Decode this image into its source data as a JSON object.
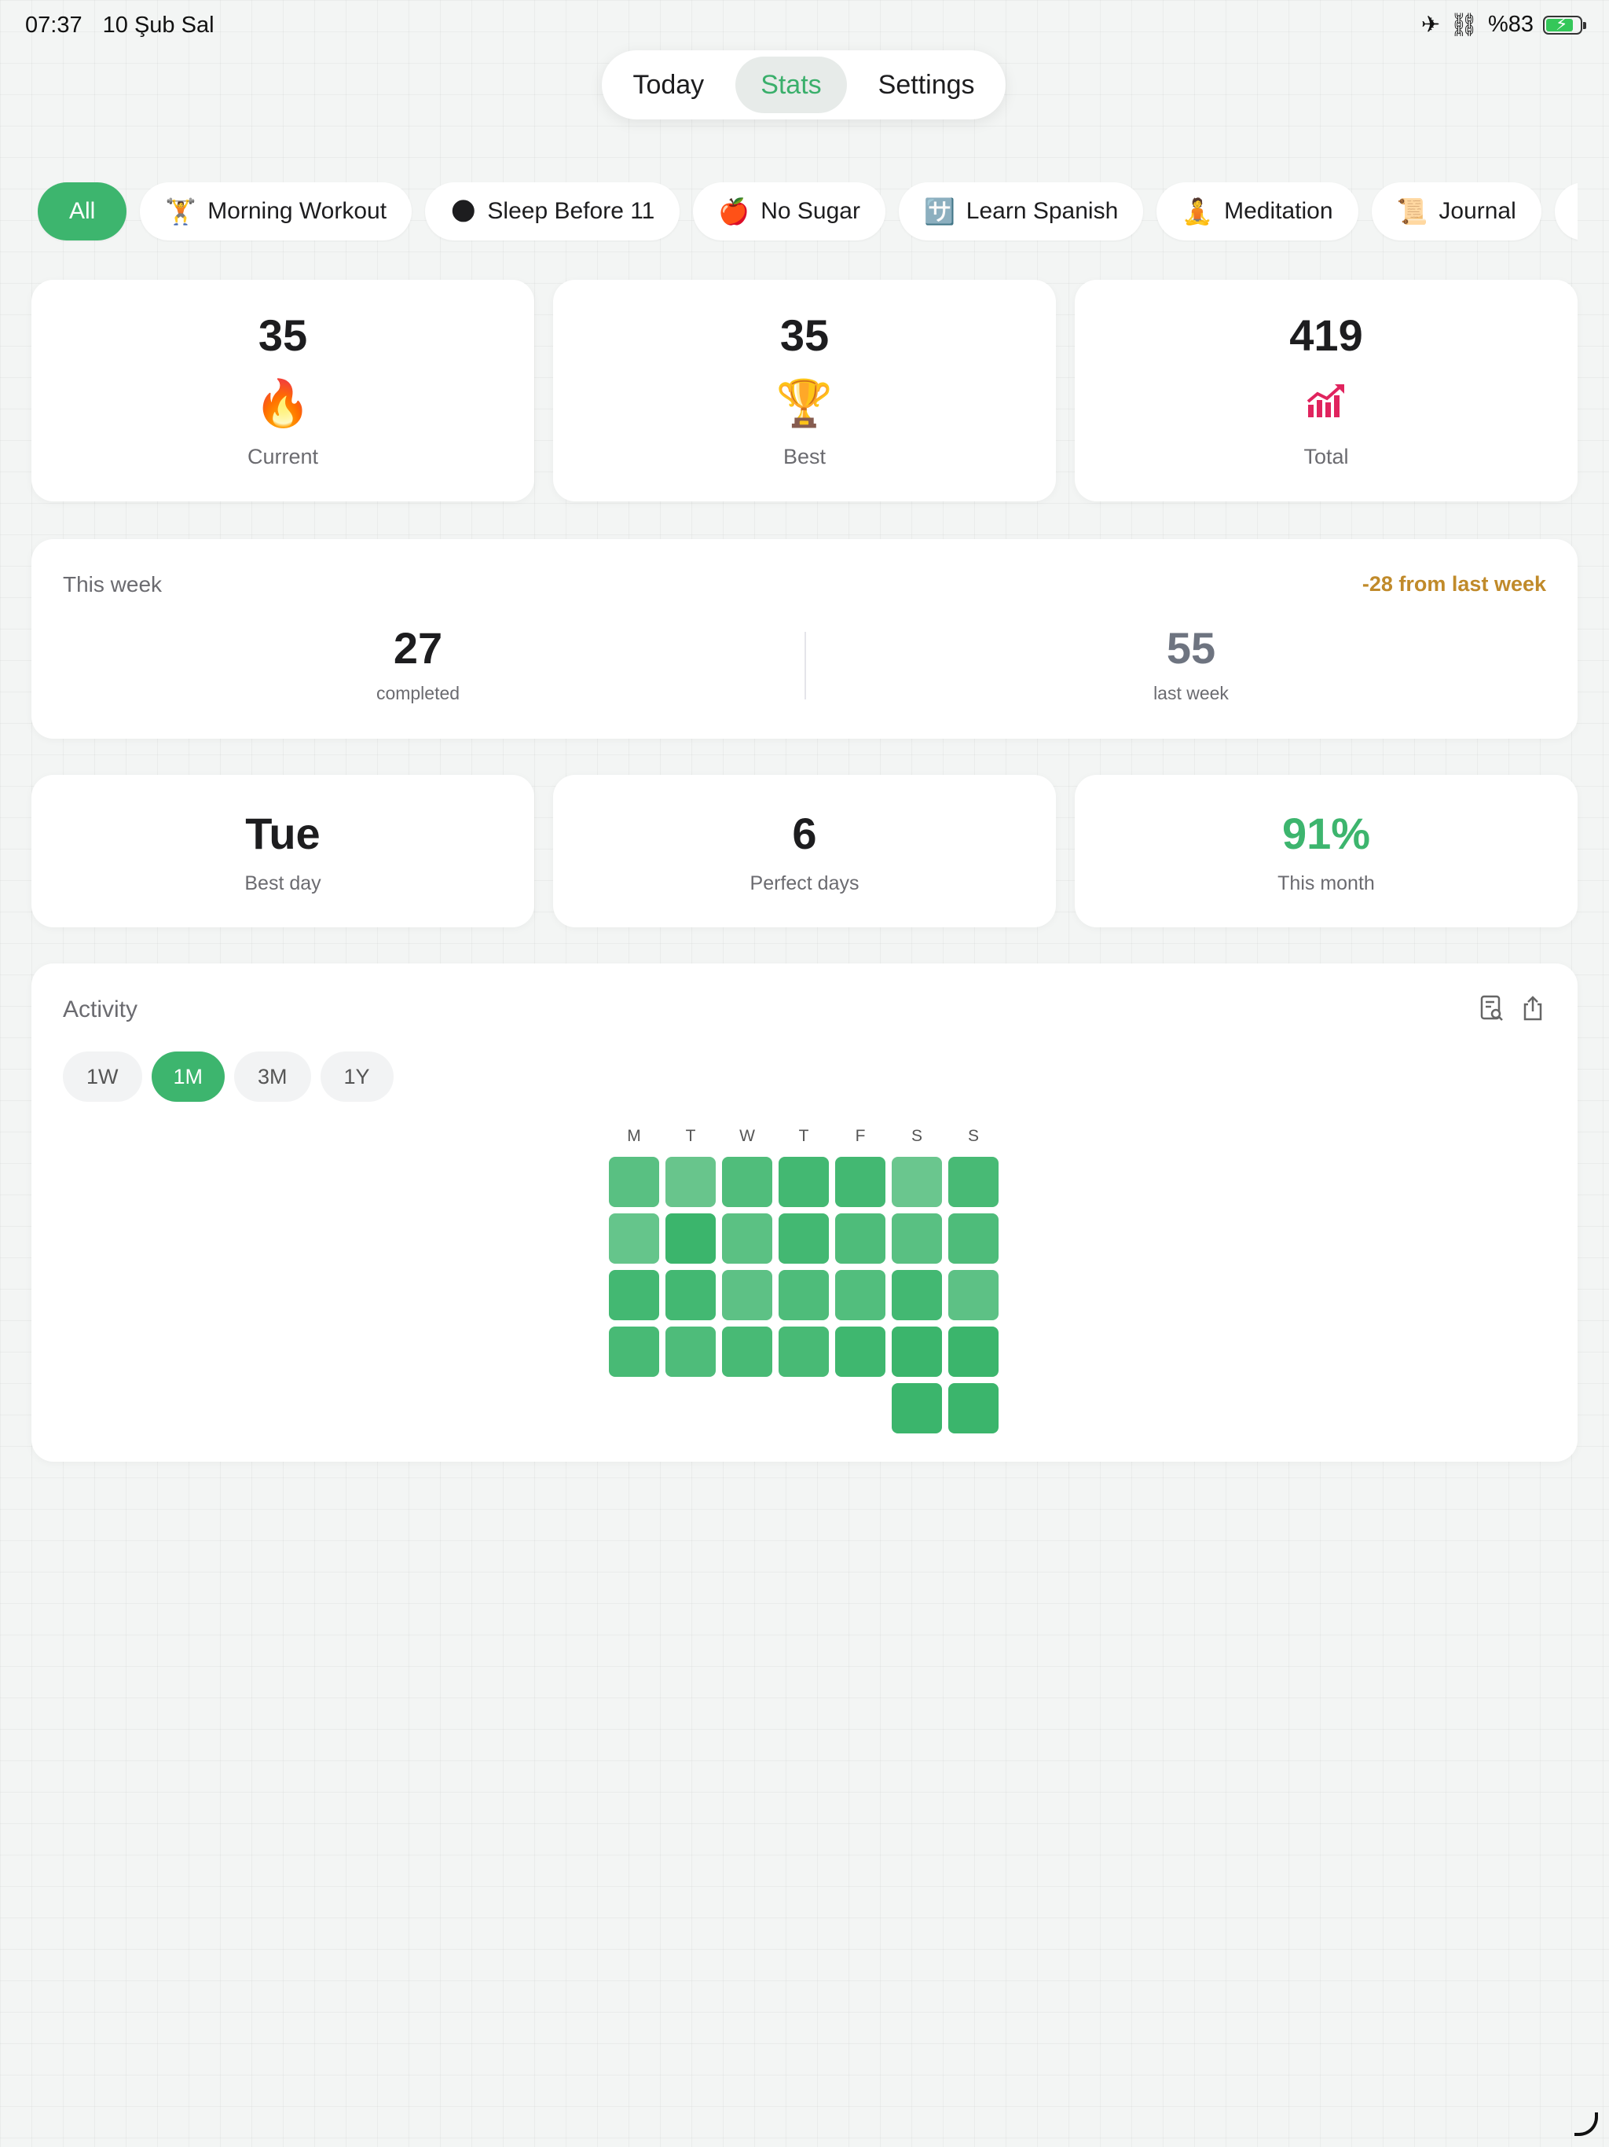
{
  "status_bar": {
    "time": "07:37",
    "date": "10 Şub Sal",
    "battery_text": "%83",
    "battery_level": 0.83
  },
  "nav": {
    "tabs": [
      {
        "label": "Today"
      },
      {
        "label": "Stats"
      },
      {
        "label": "Settings"
      }
    ],
    "active": "Stats"
  },
  "habits": [
    {
      "label": "All",
      "emoji": ""
    },
    {
      "label": "Morning Workout",
      "emoji": "🏋️"
    },
    {
      "label": "Sleep Before 11",
      "emoji": "🌑"
    },
    {
      "label": "No Sugar",
      "emoji": "🍎"
    },
    {
      "label": "Learn Spanish",
      "emoji": "🈂️"
    },
    {
      "label": "Meditation",
      "emoji": "🧘"
    },
    {
      "label": "Journal",
      "emoji": "📜"
    },
    {
      "label": "",
      "emoji": "📚"
    }
  ],
  "stats": {
    "current": {
      "value": "35",
      "label": "Current",
      "icon": "🔥"
    },
    "best": {
      "value": "35",
      "label": "Best",
      "icon": "🏆"
    },
    "total": {
      "value": "419",
      "label": "Total",
      "icon": "📶"
    }
  },
  "week": {
    "title": "This week",
    "diff": "-28 from last week",
    "completed": {
      "value": "27",
      "label": "completed"
    },
    "last_week": {
      "value": "55",
      "label": "last week"
    }
  },
  "mini": {
    "best_day": {
      "value": "Tue",
      "label": "Best day"
    },
    "perfect": {
      "value": "6",
      "label": "Perfect days"
    },
    "month": {
      "value": "91%",
      "label": "This month"
    }
  },
  "activity": {
    "title": "Activity",
    "ranges": [
      "1W",
      "1M",
      "3M",
      "1Y"
    ],
    "active_range": "1M",
    "weekdays": [
      "M",
      "T",
      "W",
      "T",
      "F",
      "S",
      "S"
    ],
    "levels": [
      [
        0.72,
        0.58,
        0.8,
        0.92,
        0.92,
        0.56,
        0.88
      ],
      [
        0.6,
        1.0,
        0.7,
        0.92,
        0.82,
        0.72,
        0.82
      ],
      [
        0.92,
        0.92,
        0.68,
        0.82,
        0.78,
        0.92,
        0.68
      ],
      [
        0.88,
        0.82,
        0.88,
        0.88,
        0.96,
        1.0,
        1.0
      ],
      [
        null,
        null,
        null,
        null,
        null,
        1.0,
        1.0
      ]
    ],
    "colors": {
      "strong": "#3bb56c",
      "light": "#a5dcb9"
    }
  },
  "colors": {
    "accent": "#3db56e",
    "warning": "#c08a2a",
    "muted": "#6b6b70"
  }
}
